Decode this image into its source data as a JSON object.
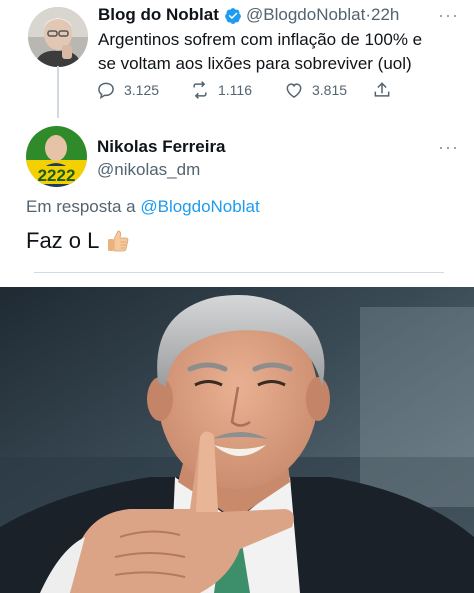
{
  "tweet": {
    "author_name": "Blog do Noblat",
    "author_handle": "@BlogdoNoblat",
    "separator": "·",
    "time": "22h",
    "more": "···",
    "text_line1": "Argentinos sofrem com inflação de 100% e",
    "text_line2": "se voltam aos lixões para sobreviver (uol)",
    "replies": "3.125",
    "retweets": "1.116",
    "likes": "3.815"
  },
  "reply": {
    "author_name": "Nikolas Ferreira",
    "author_handle": "@nikolas_dm",
    "more": "···",
    "avatar_badge": "2222",
    "reply_prefix": "Em resposta a",
    "reply_mention": "@BlogdoNoblat",
    "text": "Faz o L"
  },
  "icons": {
    "verified": "verified-badge-icon",
    "reply": "reply-icon",
    "retweet": "retweet-icon",
    "like": "heart-icon",
    "share": "share-icon",
    "emoji": "thumbs-up-emoji"
  },
  "colors": {
    "accent": "#1d9bf0",
    "secondary_text": "#536471",
    "primary_text": "#0f1419",
    "badge_yellow": "#f5d000",
    "badge_green": "#2f8a2a"
  }
}
